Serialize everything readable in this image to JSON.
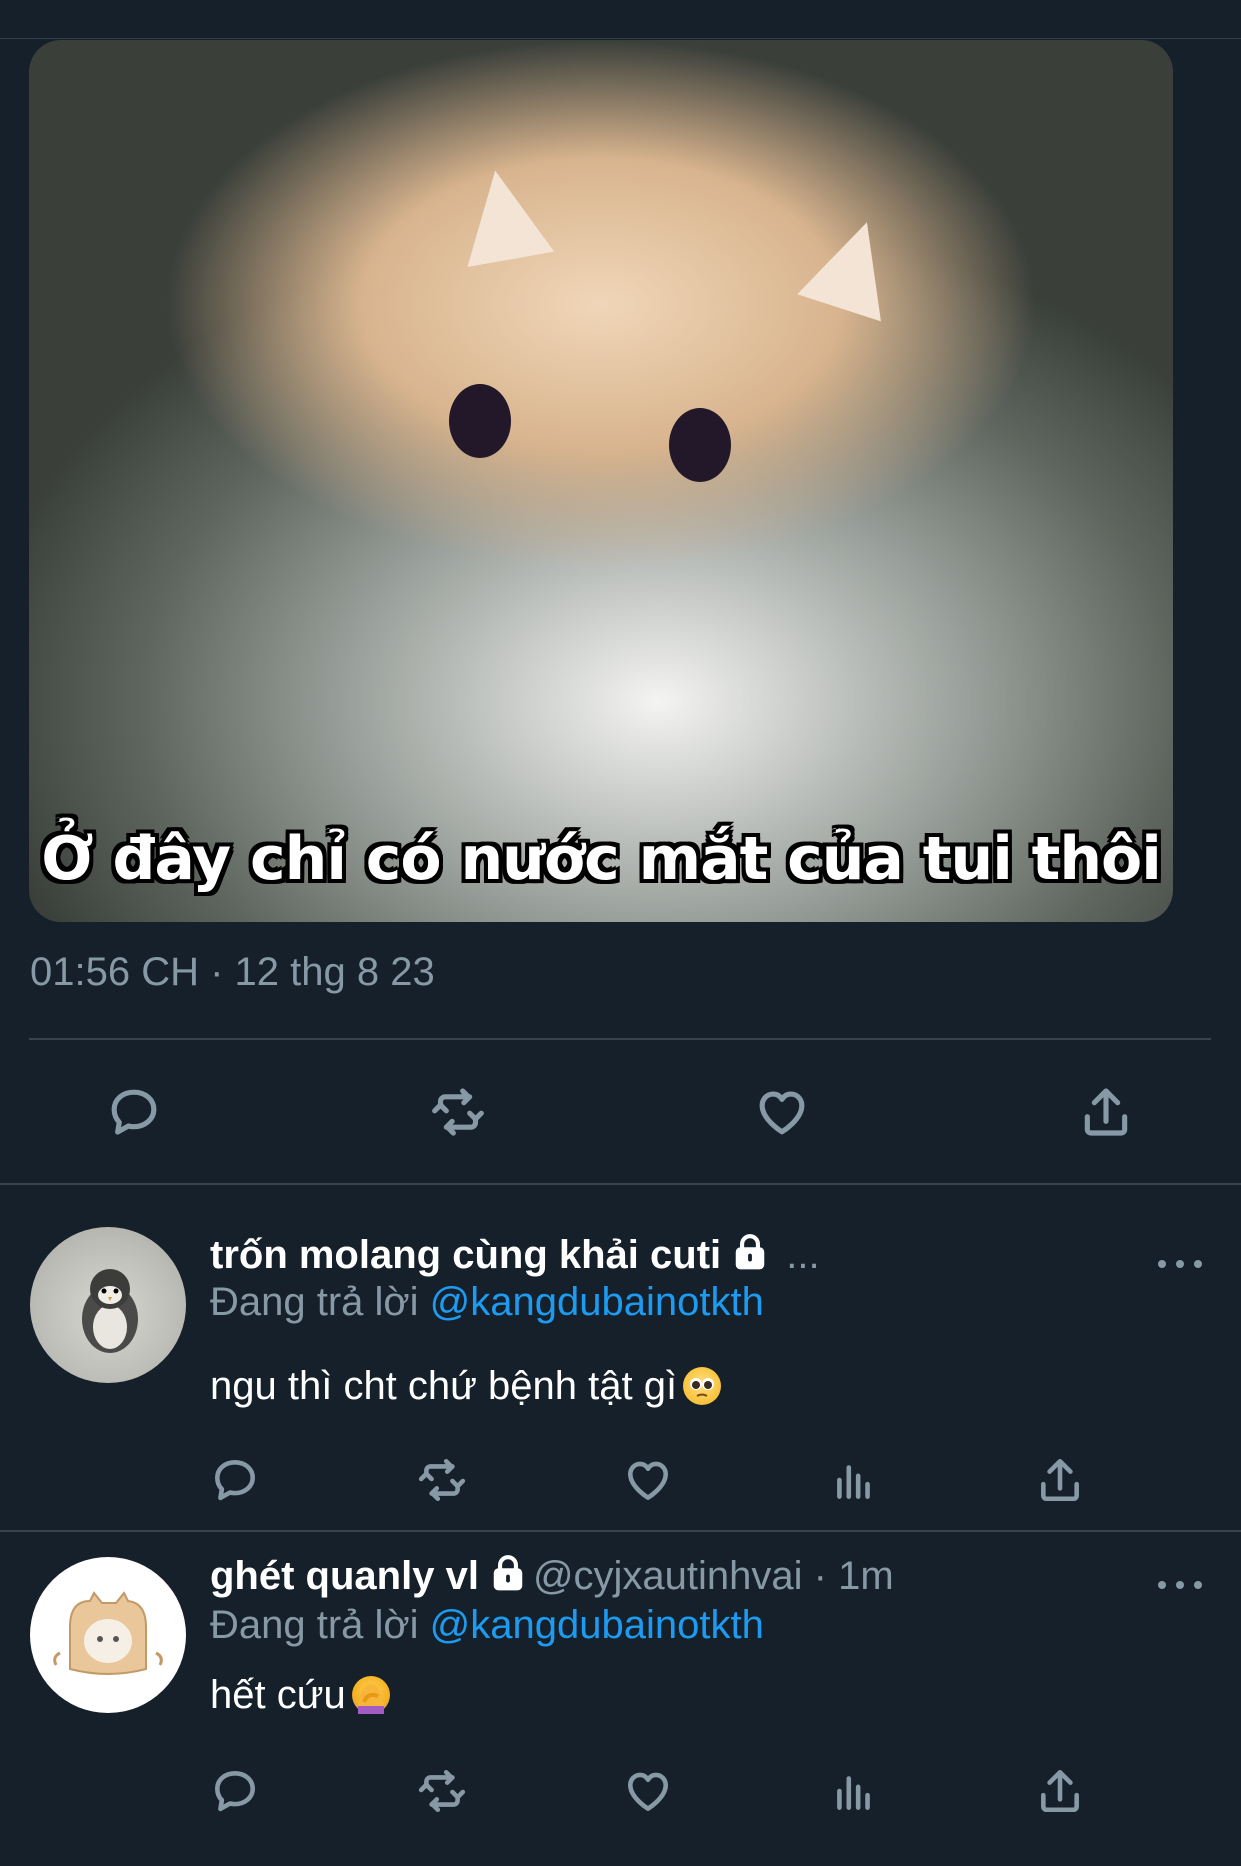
{
  "tweet": {
    "media_caption": "Ở đây chỉ có nước mắt của tui thôi",
    "timestamp": "01:56 CH · 12 thg 8 23",
    "actions": [
      "reply-icon",
      "retweet-icon",
      "like-icon",
      "share-icon"
    ]
  },
  "replies": [
    {
      "name": "trốn molang cùng khải cuti",
      "after_name": " ...",
      "protected": true,
      "replying_prefix": "Đang trả lời ",
      "replying_to": "@kangdubainotkth",
      "text": "ngu thì cht chứ bệnh tật gì",
      "emoji": "pleading-face",
      "avatar": "penguin-plush-avatar",
      "actions": [
        "reply-icon",
        "retweet-icon",
        "like-icon",
        "analytics-icon",
        "share-icon"
      ]
    },
    {
      "name": "ghét quanly vl",
      "handle": "@cyjxautinhvai",
      "time": "· 1m",
      "protected": true,
      "replying_prefix": "Đang trả lời ",
      "replying_to": "@kangdubainotkth",
      "text": "hết cứu",
      "emoji": "person-facepalming",
      "avatar": "bread-cat-avatar",
      "actions": [
        "reply-icon",
        "retweet-icon",
        "like-icon",
        "analytics-icon",
        "share-icon"
      ]
    }
  ],
  "colors": {
    "background": "#15202b",
    "muted": "#8899a6",
    "link": "#1d9bf0",
    "divider": "#38444d"
  }
}
